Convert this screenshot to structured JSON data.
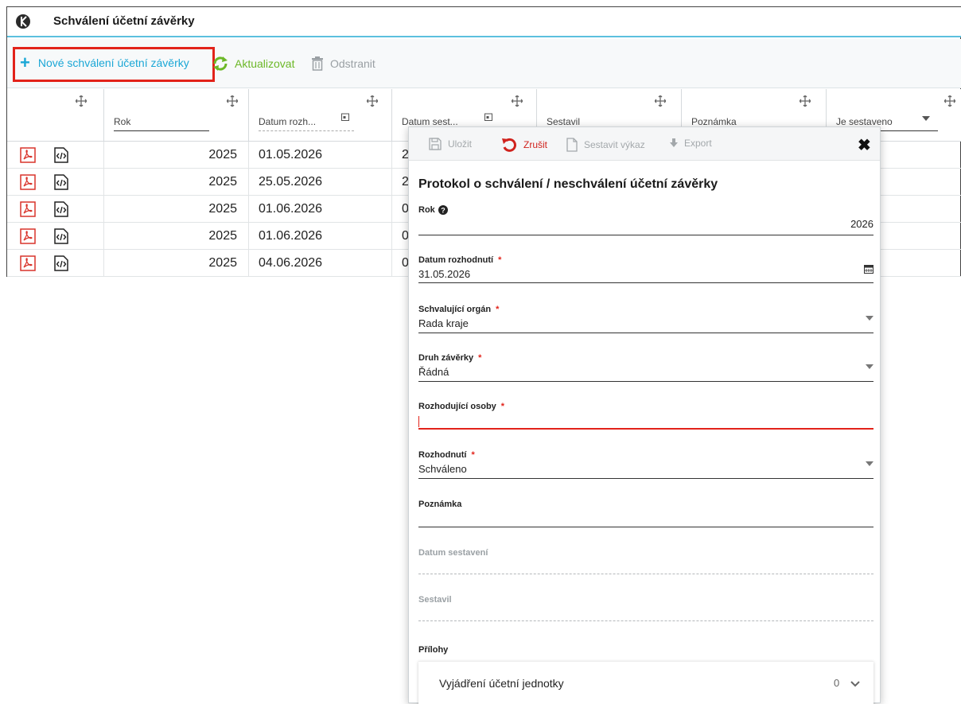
{
  "window": {
    "title": "Schválení účetní závěrky"
  },
  "toolbar": {
    "new_label": "Nové schválení účetní závěrky",
    "refresh_label": "Aktualizovat",
    "delete_label": "Odstranit"
  },
  "grid": {
    "columns": [
      "Rok",
      "Datum rozh...",
      "Datum sest...",
      "Sestavil",
      "Poznámka",
      "Je sestaveno"
    ],
    "rows": [
      {
        "rok": "2025",
        "datum_rozh": "01.05.2026",
        "datum_sest": "2"
      },
      {
        "rok": "2025",
        "datum_rozh": "25.05.2026",
        "datum_sest": "2"
      },
      {
        "rok": "2025",
        "datum_rozh": "01.06.2026",
        "datum_sest": "0"
      },
      {
        "rok": "2025",
        "datum_rozh": "01.06.2026",
        "datum_sest": "0"
      },
      {
        "rok": "2025",
        "datum_rozh": "04.06.2026",
        "datum_sest": "0"
      }
    ]
  },
  "dialog": {
    "toolbar": {
      "save": "Uložit",
      "cancel": "Zrušit",
      "build": "Sestavit výkaz",
      "export": "Export"
    },
    "title": "Protokol o schválení / neschválení účetní závěrky",
    "fields": {
      "rok": {
        "label": "Rok",
        "value": "2026"
      },
      "datum_rozhodnuti": {
        "label": "Datum rozhodnutí",
        "value": "31.05.2026"
      },
      "schvalujici_organ": {
        "label": "Schvalující orgán",
        "value": "Rada kraje"
      },
      "druh_zaverky": {
        "label": "Druh závěrky",
        "value": "Řádná"
      },
      "rozhodujici_osoby": {
        "label": "Rozhodující osoby",
        "value": ""
      },
      "rozhodnuti": {
        "label": "Rozhodnutí",
        "value": "Schváleno"
      },
      "poznamka": {
        "label": "Poznámka",
        "value": ""
      },
      "datum_sestaveni": {
        "label": "Datum sestavení",
        "value": ""
      },
      "sestavil": {
        "label": "Sestavil",
        "value": ""
      }
    },
    "required_mark": "*",
    "attachments": {
      "heading": "Přílohy",
      "items": [
        {
          "label": "Vyjádření účetní jednotky",
          "count": "0"
        }
      ]
    }
  },
  "colors": {
    "accent": "#1ba7d6",
    "refresh": "#6cb827",
    "danger": "#e2231a",
    "title_border": "#5bc0de"
  }
}
